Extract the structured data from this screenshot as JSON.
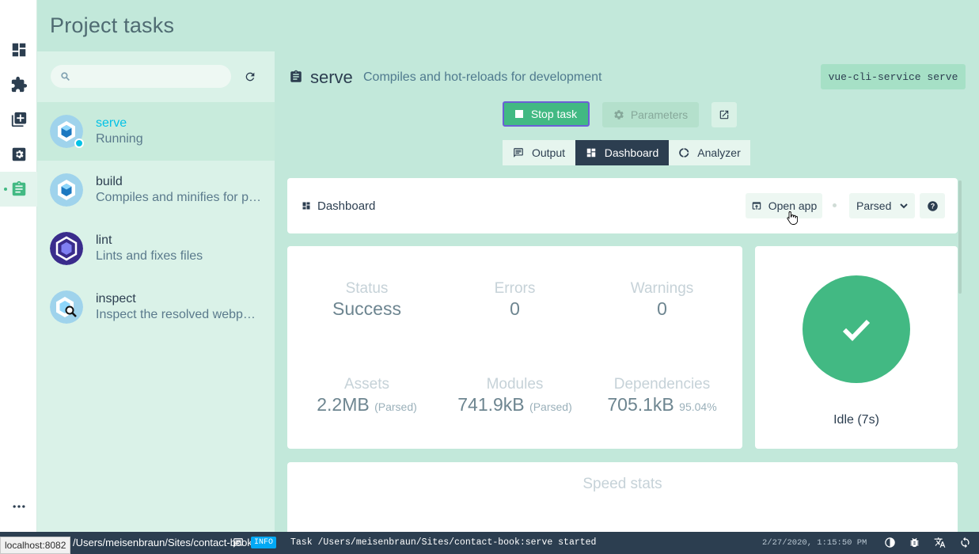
{
  "header": {
    "title": "Project tasks"
  },
  "sidebar": {
    "items": [
      {
        "name": "dashboard-icon"
      },
      {
        "name": "plugins-icon"
      },
      {
        "name": "dependencies-icon"
      },
      {
        "name": "configuration-icon"
      },
      {
        "name": "tasks-icon",
        "active": true
      }
    ],
    "more_icon": "more-icon"
  },
  "task_list": {
    "search_placeholder": "",
    "tasks": [
      {
        "name": "serve",
        "description": "Running",
        "selected": true,
        "status": "running"
      },
      {
        "name": "build",
        "description": "Compiles and minifies for production"
      },
      {
        "name": "lint",
        "description": "Lints and fixes files"
      },
      {
        "name": "inspect",
        "description": "Inspect the resolved webpack config"
      }
    ]
  },
  "task_detail": {
    "name": "serve",
    "description": "Compiles and hot-reloads for development",
    "command": "vue-cli-service serve",
    "stop_label": "Stop task",
    "parameters_label": "Parameters",
    "tabs": [
      {
        "label": "Output",
        "icon": "output-icon"
      },
      {
        "label": "Dashboard",
        "icon": "dashboard-icon",
        "active": true
      },
      {
        "label": "Analyzer",
        "icon": "analyzer-icon"
      }
    ]
  },
  "dashboard": {
    "title": "Dashboard",
    "open_app_label": "Open app",
    "view_mode": "Parsed",
    "stats": {
      "status": {
        "label": "Status",
        "value": "Success"
      },
      "errors": {
        "label": "Errors",
        "value": "0"
      },
      "warnings": {
        "label": "Warnings",
        "value": "0"
      },
      "assets": {
        "label": "Assets",
        "value": "2.2MB",
        "suffix": "(Parsed)"
      },
      "modules": {
        "label": "Modules",
        "value": "741.9kB",
        "suffix": "(Parsed)"
      },
      "dependencies": {
        "label": "Dependencies",
        "value": "705.1kB",
        "suffix": "95.04%"
      }
    },
    "idle_text": "Idle (7s)",
    "speed_stats_title": "Speed stats"
  },
  "statusbar": {
    "cwd": "/Users/meisenbraun/Sites/contact-book",
    "log_badge": "INFO",
    "log_message": "Task /Users/meisenbraun/Sites/contact-book:serve started",
    "datetime": "2/27/2020, 1:15:50 PM"
  },
  "tooltip": {
    "url": "localhost:8082"
  },
  "colors": {
    "accent": "#42b983",
    "running": "#03c2e6",
    "dark": "#2c3e50",
    "background": "#c2e8da"
  }
}
